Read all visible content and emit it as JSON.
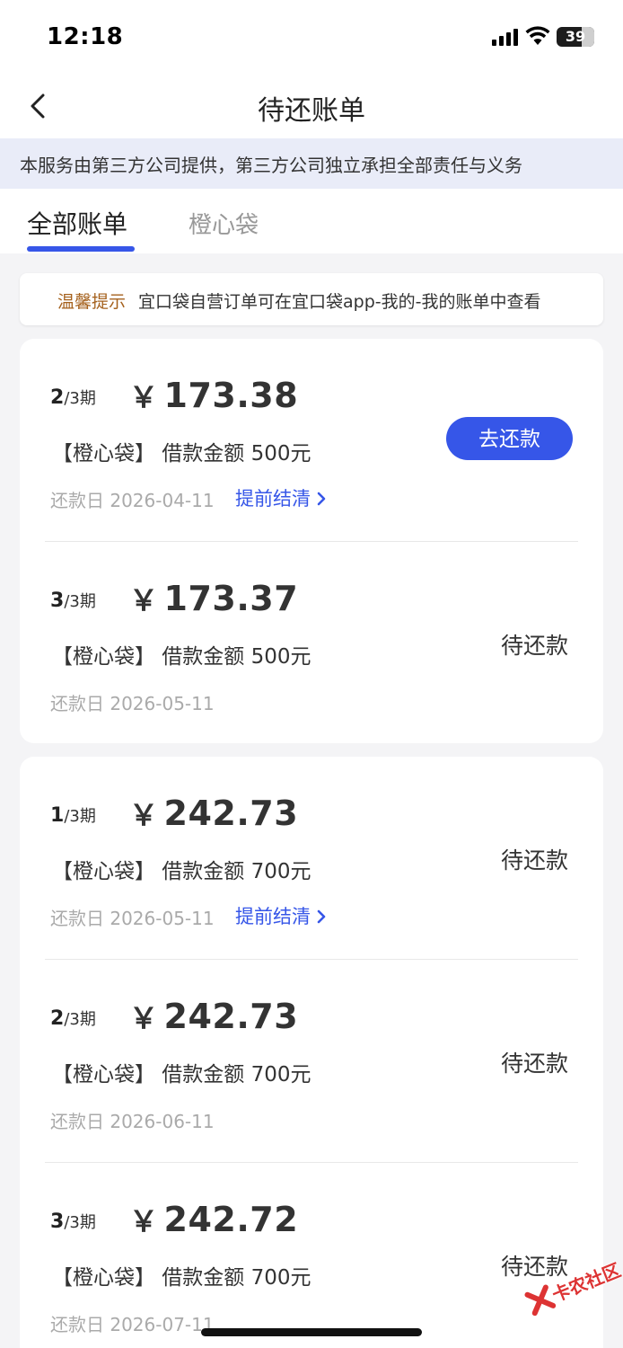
{
  "status_bar": {
    "time": "12:18",
    "battery": "39"
  },
  "nav": {
    "title": "待还账单"
  },
  "notice": "本服务由第三方公司提供，第三方公司独立承担全部责任与义务",
  "tabs": [
    {
      "label": "全部账单",
      "active": true
    },
    {
      "label": "橙心袋",
      "active": false
    }
  ],
  "tip": {
    "label": "温馨提示",
    "text": "宜口袋自营订单可在宜口袋app-我的-我的账单中查看"
  },
  "cards": [
    {
      "bills": [
        {
          "period_current": "2",
          "period_total": "/3期",
          "currency": "￥",
          "amount": "173.38",
          "product": "【橙心袋】 借款金额 500元",
          "due": "还款日 2026-04-11",
          "early_settle": "提前结清",
          "action": "去还款",
          "status": ""
        },
        {
          "period_current": "3",
          "period_total": "/3期",
          "currency": "￥",
          "amount": "173.37",
          "product": "【橙心袋】 借款金额 500元",
          "due": "还款日 2026-05-11",
          "early_settle": "",
          "action": "",
          "status": "待还款"
        }
      ]
    },
    {
      "bills": [
        {
          "period_current": "1",
          "period_total": "/3期",
          "currency": "￥",
          "amount": "242.73",
          "product": "【橙心袋】 借款金额 700元",
          "due": "还款日 2026-05-11",
          "early_settle": "提前结清",
          "action": "",
          "status": "待还款"
        },
        {
          "period_current": "2",
          "period_total": "/3期",
          "currency": "￥",
          "amount": "242.73",
          "product": "【橙心袋】 借款金额 700元",
          "due": "还款日 2026-06-11",
          "early_settle": "",
          "action": "",
          "status": "待还款"
        },
        {
          "period_current": "3",
          "period_total": "/3期",
          "currency": "￥",
          "amount": "242.72",
          "product": "【橙心袋】 借款金额 700元",
          "due": "还款日 2026-07-11",
          "early_settle": "",
          "action": "",
          "status": "待还款"
        }
      ]
    }
  ],
  "watermark": {
    "text": "卡农社区"
  },
  "colors": {
    "accent": "#3656e8",
    "tip_label": "#a5611d",
    "background": "#f4f4f6"
  }
}
